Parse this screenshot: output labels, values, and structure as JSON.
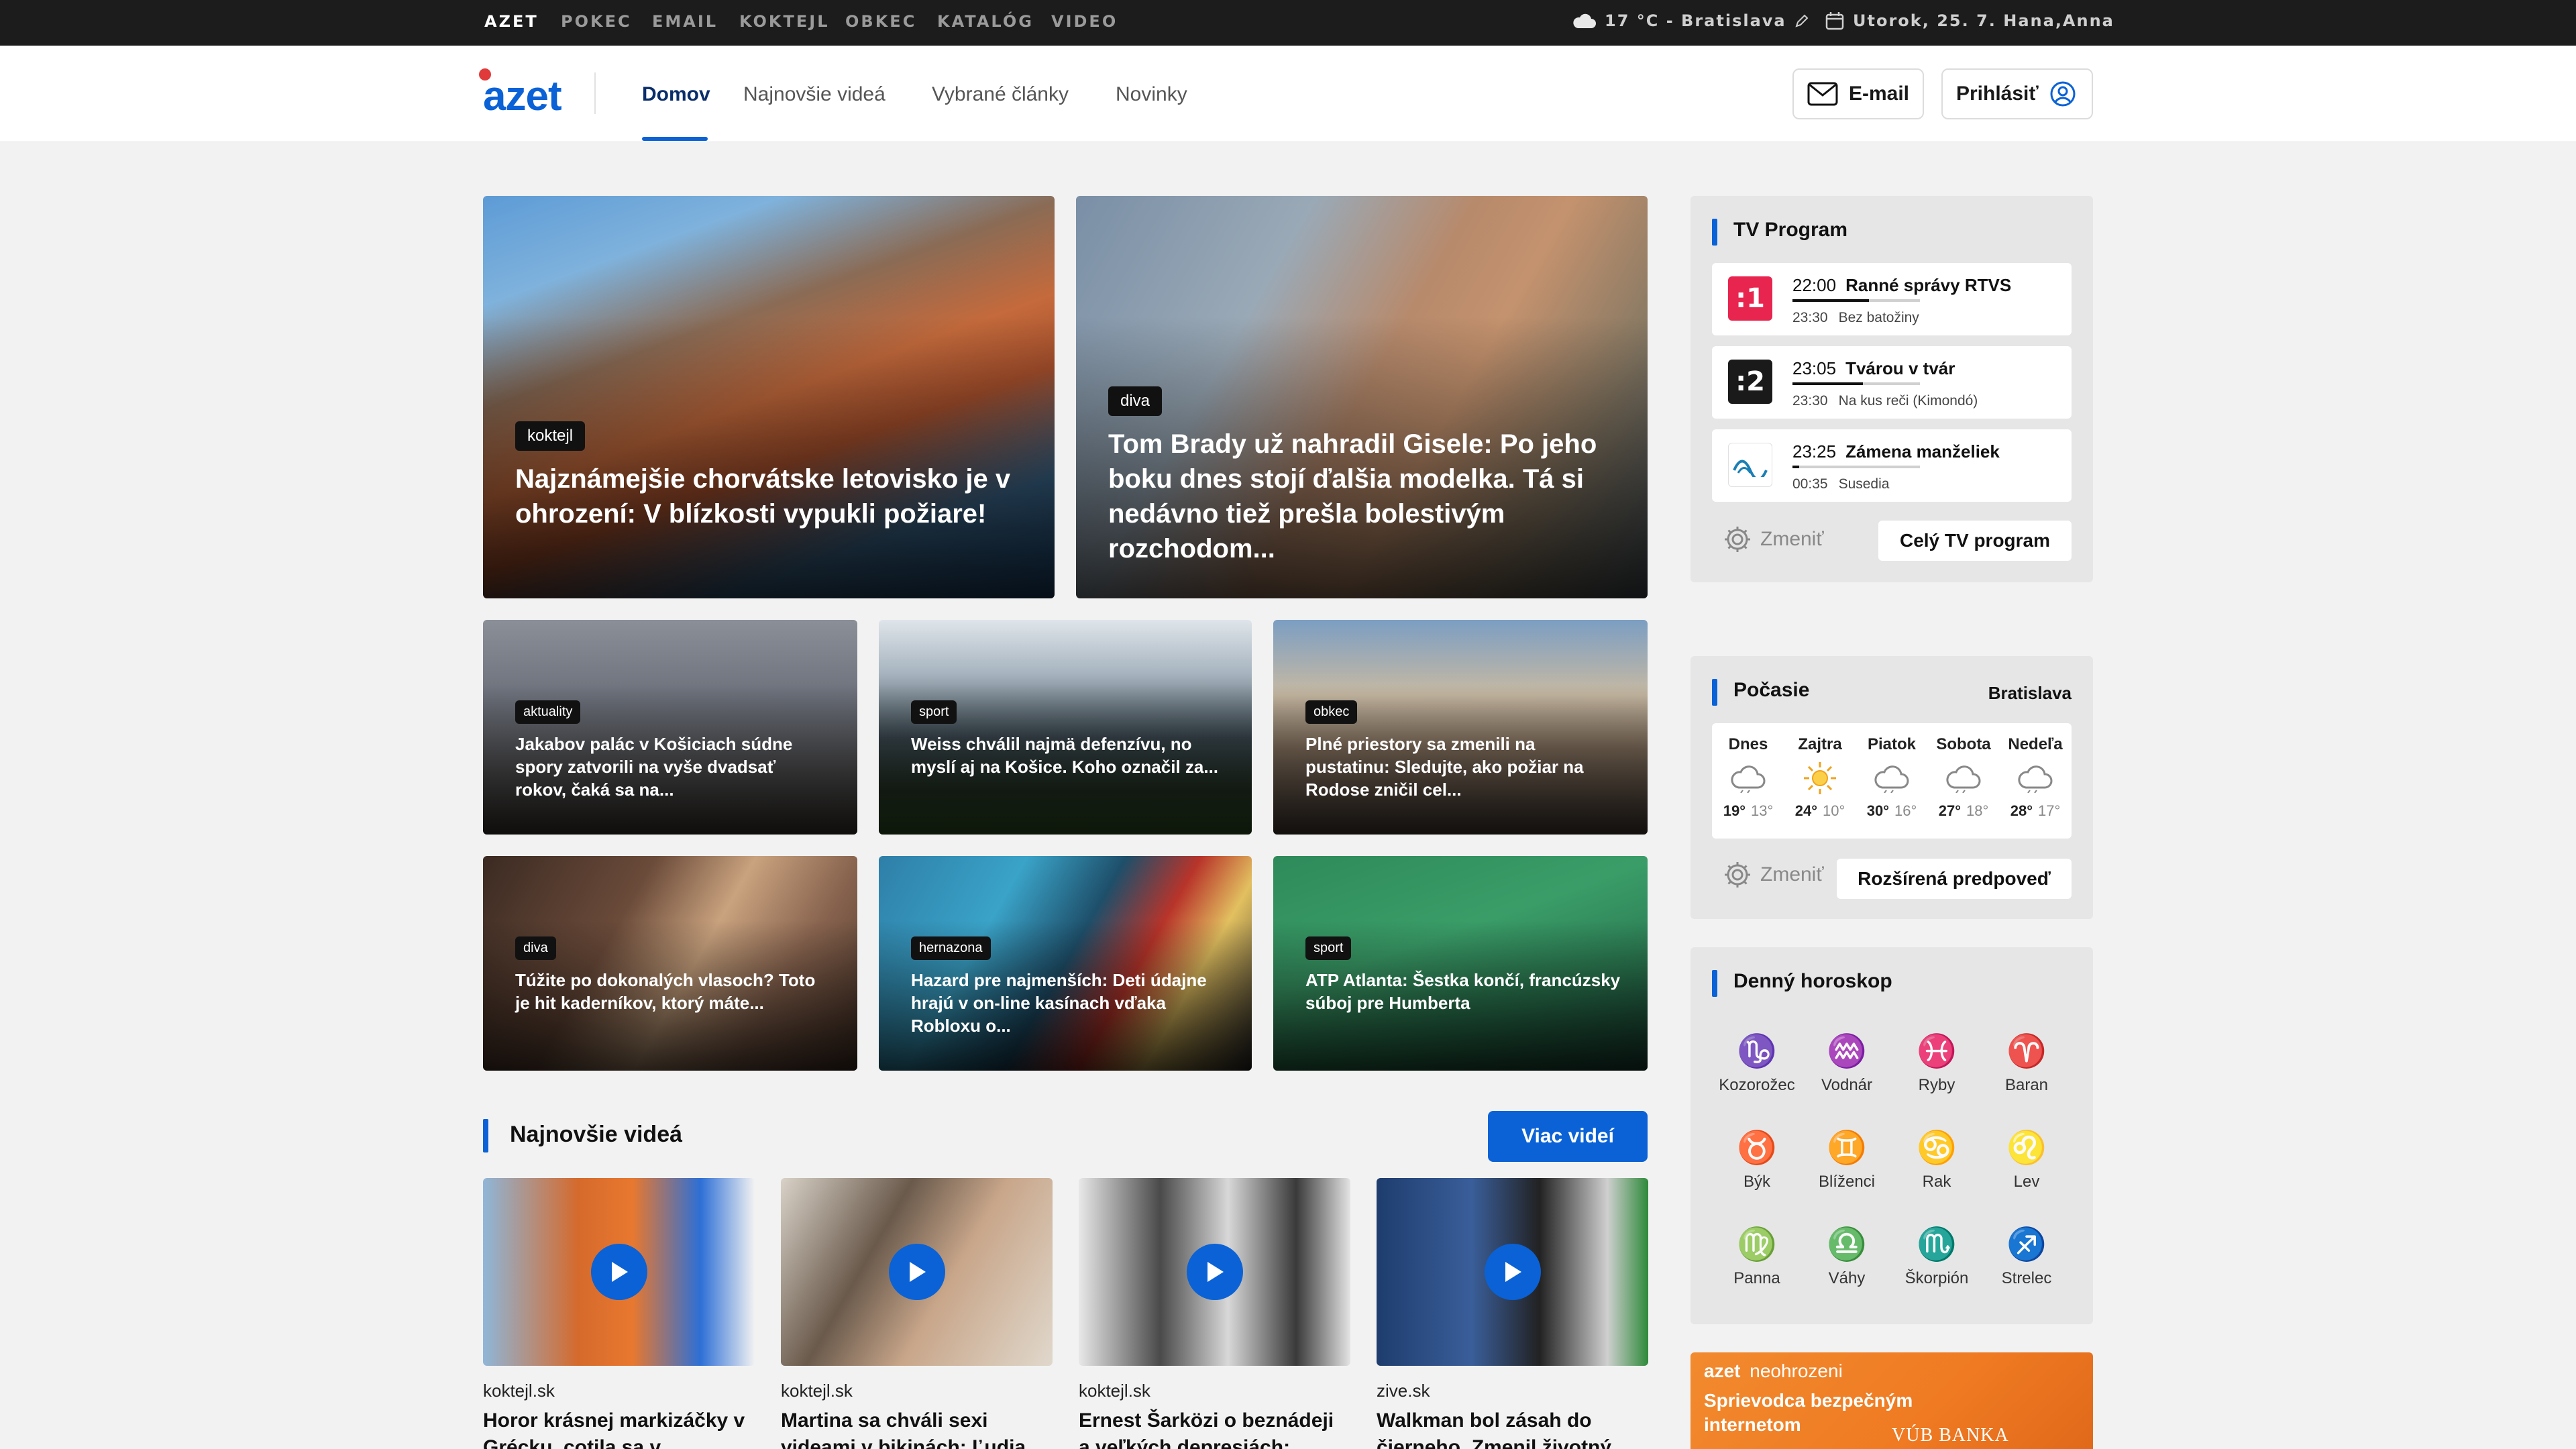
{
  "topbar": {
    "links": [
      "AZET",
      "POKEC",
      "EMAIL",
      "KOKTEJL",
      "OBKEC",
      "KATALÓG",
      "VIDEO"
    ],
    "weather": "17 °C - Bratislava",
    "date": "Utorok, 25. 7. Hana,Anna"
  },
  "header": {
    "logo": "azet",
    "nav": [
      "Domov",
      "Najnovšie videá",
      "Vybrané články",
      "Novinky"
    ],
    "email_label": "E-mail",
    "login_label": "Prihlásiť"
  },
  "hero": [
    {
      "badge": "koktejl",
      "title": "Najznámejšie chorvátske letovisko je v ohrození: V blízkosti vypukli požiare!"
    },
    {
      "badge": "diva",
      "title": "Tom Brady už nahradil Gisele: Po jeho boku dnes stojí ďalšia modelka. Tá si nedávno tiež prešla bolestivým rozchodom..."
    }
  ],
  "articles": [
    {
      "badge": "aktuality",
      "title": "Jakabov palác v Košiciach súdne spory zatvorili na vyše dvadsať rokov, čaká sa na..."
    },
    {
      "badge": "sport",
      "title": "Weiss chválil najmä defenzívu, no myslí aj na Košice. Koho označil za..."
    },
    {
      "badge": "obkec",
      "title": "Plné priestory sa zmenili na pustatinu: Sledujte, ako požiar na Rodose zničil cel..."
    },
    {
      "badge": "diva",
      "title": "Túžite po dokonalých vlasoch? Toto je hit kaderníkov, ktorý máte..."
    },
    {
      "badge": "hernazona",
      "title": "Hazard pre najmenších: Deti údajne hrajú v on-line kasínach vďaka Robloxu o..."
    },
    {
      "badge": "sport",
      "title": "ATP Atlanta: Šestka končí, francúzsky súboj pre Humberta"
    }
  ],
  "videos_section": {
    "title": "Najnovšie videá",
    "more_label": "Viac videí",
    "items": [
      {
        "source": "koktejl.sk",
        "title": "Horor krásnej markizáčky v Grécku, cotila sa v..."
      },
      {
        "source": "koktejl.sk",
        "title": "Martina sa chváli sexi videami v bikinách: Ľudia ju..."
      },
      {
        "source": "koktejl.sk",
        "title": "Ernest Šarközi o beznádeji a veľkých depresiách:..."
      },
      {
        "source": "zive.sk",
        "title": "Walkman bol zásah do čierneho. Zmenil životný..."
      }
    ]
  },
  "tv": {
    "title": "TV Program",
    "channels": [
      {
        "logo": ":1",
        "color": "#e8254f",
        "time": "22:00",
        "show": "Ranné správy RTVS",
        "next_time": "23:30",
        "next_show": "Bez batožiny",
        "progress": 0.6
      },
      {
        "logo": ":2",
        "color": "#1a1a1a",
        "time": "23:05",
        "show": "Tvárou v tvár",
        "next_time": "23:30",
        "next_show": "Na kus reči (Kimondó)",
        "progress": 0.55
      },
      {
        "logo": "~",
        "color": "#ffffff",
        "time": "23:25",
        "show": "Zámena manželiek",
        "next_time": "00:35",
        "next_show": "Susedia",
        "progress": 0.05
      }
    ],
    "change_label": "Zmeniť",
    "full_label": "Celý TV program"
  },
  "weather": {
    "title": "Počasie",
    "city": "Bratislava",
    "days": [
      {
        "name": "Dnes",
        "icon": "cloud-icon",
        "high": "19°",
        "low": "13°"
      },
      {
        "name": "Zajtra",
        "icon": "sun-icon",
        "high": "24°",
        "low": "10°"
      },
      {
        "name": "Piatok",
        "icon": "cloud-icon",
        "high": "30°",
        "low": "16°"
      },
      {
        "name": "Sobota",
        "icon": "cloud-icon",
        "high": "27°",
        "low": "18°"
      },
      {
        "name": "Nedeľa",
        "icon": "cloud-icon",
        "high": "28°",
        "low": "17°"
      }
    ],
    "change_label": "Zmeniť",
    "forecast_label": "Rozšírená predpoveď"
  },
  "horoscope": {
    "title": "Denný horoskop",
    "signs": [
      {
        "symbol": "♑",
        "name": "Kozorožec"
      },
      {
        "symbol": "♒",
        "name": "Vodnár"
      },
      {
        "symbol": "♓",
        "name": "Ryby"
      },
      {
        "symbol": "♈",
        "name": "Baran"
      },
      {
        "symbol": "♉",
        "name": "Býk"
      },
      {
        "symbol": "♊",
        "name": "Blíženci"
      },
      {
        "symbol": "♋",
        "name": "Rak"
      },
      {
        "symbol": "♌",
        "name": "Lev"
      },
      {
        "symbol": "♍",
        "name": "Panna"
      },
      {
        "symbol": "♎",
        "name": "Váhy"
      },
      {
        "symbol": "♏",
        "name": "Škorpión"
      },
      {
        "symbol": "♐",
        "name": "Strelec"
      }
    ]
  },
  "ad": {
    "brand": "azet",
    "tag": "neohrozeni",
    "title": "Sprievodca bezpečným internetom",
    "sponsor": "VÚB BANKA"
  },
  "colors": {
    "accent": "#0a62d6",
    "topbar": "#1c1c1c",
    "ad": "#f07a24"
  }
}
